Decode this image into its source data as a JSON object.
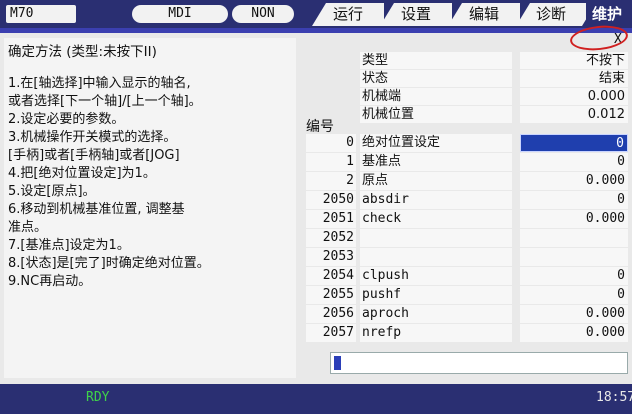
{
  "topbar": {
    "model": "M70",
    "mode": "MDI",
    "mode2": "NON",
    "tabs": [
      {
        "label": "运行"
      },
      {
        "label": "设置"
      },
      {
        "label": "编辑"
      },
      {
        "label": "诊断"
      },
      {
        "label": "维护"
      }
    ]
  },
  "close": {
    "label": "X"
  },
  "help": {
    "title": "确定方法 (类型:未按下II)",
    "lines": [
      "1.在[轴选择]中输入显示的轴名,",
      "  或者选择[下一个轴]/[上一个轴]。",
      "2.设定必要的参数。",
      "3.机械操作开关模式的选择。",
      "  [手柄]或者[手柄轴]或者[JOG]",
      "4.把[绝对位置设定]为1。",
      "5.设定[原点]。",
      "6.移动到机械基准位置, 调整基",
      "  准点。",
      "7.[基准点]设定为1。",
      "8.[状态]是[完了]时确定绝对位置。",
      "9.NC再启动。"
    ]
  },
  "status": [
    {
      "label": "类型",
      "value": "不按下"
    },
    {
      "label": "状态",
      "value": "结束"
    },
    {
      "label": "机械端",
      "value": "0.000"
    },
    {
      "label": "机械位置",
      "value": "0.012"
    }
  ],
  "table": {
    "header_no": "编号",
    "rows": [
      {
        "no": "0",
        "name": "绝对位置设定",
        "value": "0"
      },
      {
        "no": "1",
        "name": "基准点",
        "value": "0"
      },
      {
        "no": "2",
        "name": "原点",
        "value": "0.000"
      },
      {
        "no": "2050",
        "name": "absdir",
        "value": "0"
      },
      {
        "no": "2051",
        "name": "check",
        "value": "0.000"
      },
      {
        "no": "2052",
        "name": "",
        "value": ""
      },
      {
        "no": "2053",
        "name": "",
        "value": ""
      },
      {
        "no": "2054",
        "name": "clpush",
        "value": "0"
      },
      {
        "no": "2055",
        "name": "pushf",
        "value": "0"
      },
      {
        "no": "2056",
        "name": "aproch",
        "value": "0.000"
      },
      {
        "no": "2057",
        "name": "nrefp",
        "value": "0.000"
      }
    ]
  },
  "bottombar": {
    "status": "RDY",
    "clock": "18:57"
  }
}
